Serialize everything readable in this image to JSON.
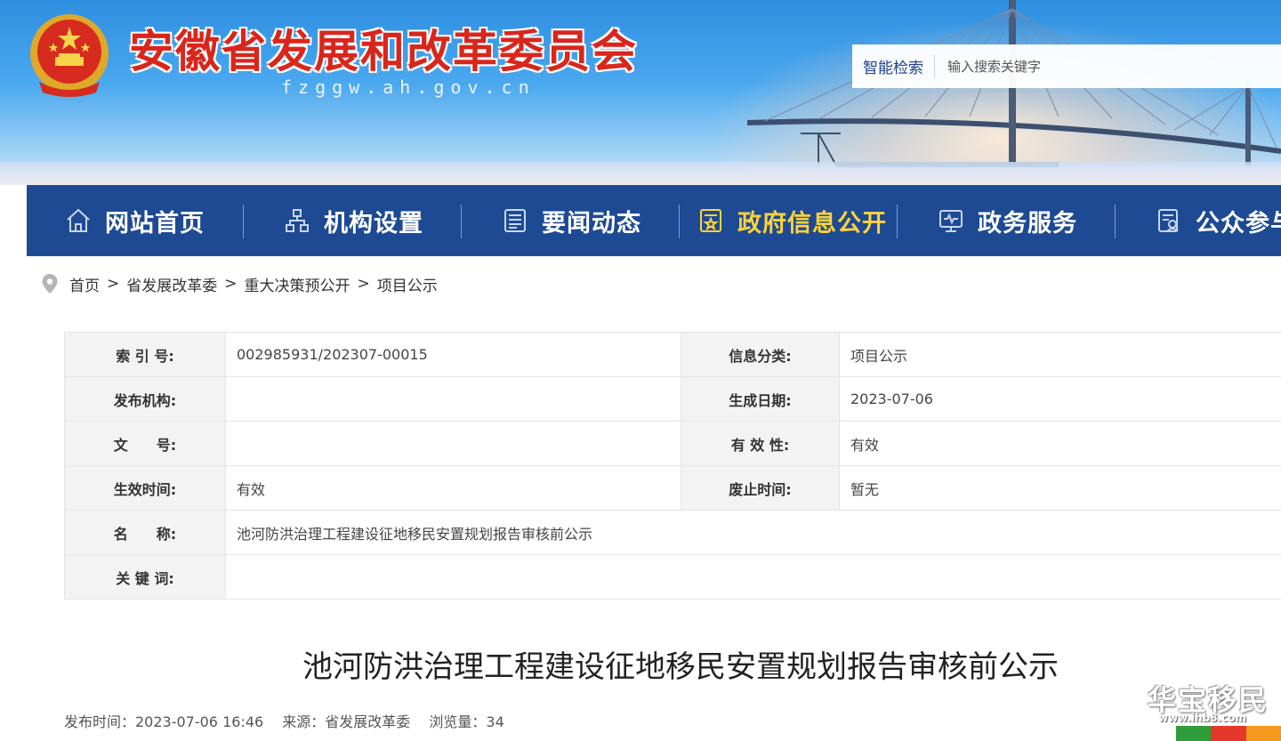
{
  "header": {
    "site_title": "安徽省发展和改革委员会",
    "site_domain": "fzggw.ah.gov.cn",
    "search_label": "智能检索",
    "search_placeholder": "输入搜索关键字"
  },
  "nav": {
    "items": [
      {
        "label": "网站首页",
        "icon": "home-icon"
      },
      {
        "label": "机构设置",
        "icon": "org-chart-icon"
      },
      {
        "label": "要闻动态",
        "icon": "news-icon"
      },
      {
        "label": "政府信息公开",
        "icon": "gov-info-icon",
        "active": true
      },
      {
        "label": "政务服务",
        "icon": "monitor-service-icon"
      },
      {
        "label": "公众参与",
        "icon": "public-participation-icon"
      }
    ],
    "colors": {
      "background": "#1d4a93",
      "text": "#ffffff",
      "active_text": "#ffd33a"
    }
  },
  "breadcrumb": {
    "icon": "location-pin-icon",
    "items": [
      "首页",
      "省发展改革委",
      "重大决策预公开",
      "项目公示"
    ],
    "separator": ">"
  },
  "info": {
    "index_label": "索 引 号:",
    "index_value": "002985931/202307-00015",
    "category_label": "信息分类:",
    "category_value": "项目公示",
    "publisher_label": "发布机构:",
    "publisher_value": "",
    "created_label": "生成日期:",
    "created_value": "2023-07-06",
    "doc_no_label": "文　　号:",
    "doc_no_value": "",
    "validity_label": "有 效 性:",
    "validity_value": "有效",
    "effective_label": "生效时间:",
    "effective_value": "有效",
    "expiry_label": "废止时间:",
    "expiry_value": "暂无",
    "name_label": "名　　称:",
    "name_value": "池河防洪治理工程建设征地移民安置规划报告审核前公示",
    "keywords_label": "关 键 词:",
    "keywords_value": ""
  },
  "article": {
    "title": "池河防洪治理工程建设征地移民安置规划报告审核前公示",
    "publish_time": "发布时间：2023-07-06 16:46",
    "source": "来源：省发展改革委",
    "views": "浏览量：34"
  },
  "watermark": {
    "text": "华宝移民",
    "url": "www.ihb8.com",
    "colors": [
      "#2e9d3a",
      "#e5382b",
      "#f39a1e"
    ]
  },
  "colors": {
    "title_red": "#d9261c",
    "banner_blue": "#2e8fe0"
  }
}
